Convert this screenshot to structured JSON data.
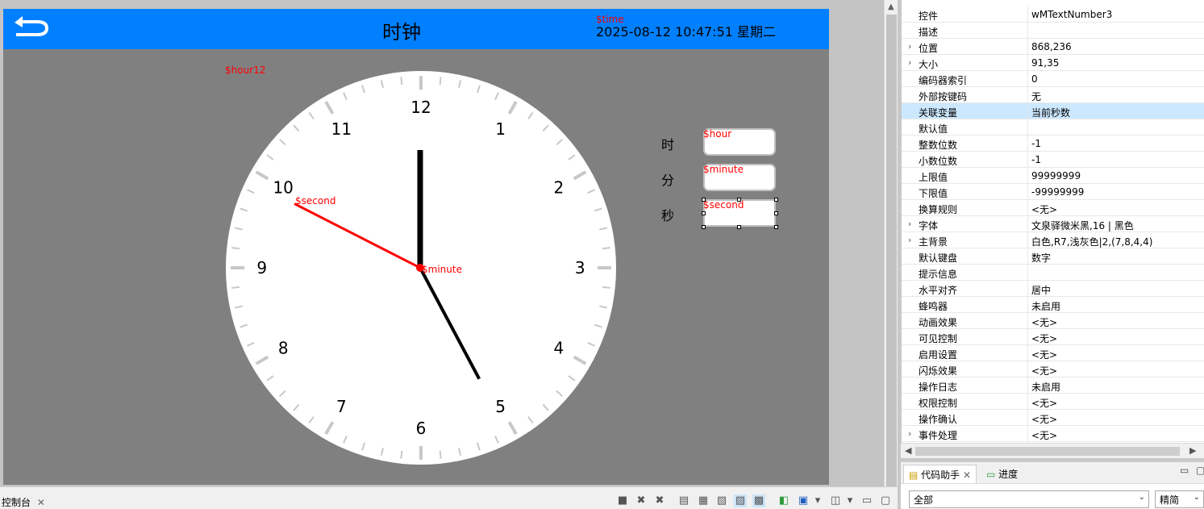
{
  "screen": {
    "title": "时钟",
    "time_text": "2025-08-12 10:47:51 星期二",
    "time_var": "$time",
    "hour12_var": "$hour12"
  },
  "clock": {
    "numbers": [
      "12",
      "1",
      "2",
      "3",
      "4",
      "5",
      "6",
      "7",
      "8",
      "9",
      "10",
      "11"
    ],
    "second_var": "$second",
    "minute_var": "$minute",
    "hour_angle_deg": 0,
    "minute_angle_deg": 152,
    "second_angle_deg": 297
  },
  "readout": {
    "hour_label": "时",
    "minute_label": "分",
    "second_label": "秒",
    "hour_var": "$hour",
    "minute_var": "$minute",
    "second_var": "$second"
  },
  "properties": {
    "rows": [
      {
        "name": "控件",
        "value": "wMTextNumber3",
        "expandable": false
      },
      {
        "name": "描述",
        "value": "",
        "expandable": false
      },
      {
        "name": "位置",
        "value": "868,236",
        "expandable": true
      },
      {
        "name": "大小",
        "value": "91,35",
        "expandable": true
      },
      {
        "name": "编码器索引",
        "value": "0",
        "expandable": false
      },
      {
        "name": "外部按键码",
        "value": "无",
        "expandable": false
      },
      {
        "name": "关联变量",
        "value": "当前秒数",
        "expandable": false,
        "selected": true
      },
      {
        "name": "默认值",
        "value": "",
        "expandable": false
      },
      {
        "name": "整数位数",
        "value": "-1",
        "expandable": false
      },
      {
        "name": "小数位数",
        "value": "-1",
        "expandable": false
      },
      {
        "name": "上限值",
        "value": "99999999",
        "expandable": false
      },
      {
        "name": "下限值",
        "value": "-99999999",
        "expandable": false
      },
      {
        "name": "换算规则",
        "value": "<无>",
        "expandable": false
      },
      {
        "name": "字体",
        "value": "文泉驿微米黑,16 | 黑色",
        "expandable": true
      },
      {
        "name": "主背景",
        "value": "白色,R7,浅灰色|2,(7,8,4,4)",
        "expandable": true
      },
      {
        "name": "默认键盘",
        "value": "数字",
        "expandable": false
      },
      {
        "name": "提示信息",
        "value": "",
        "expandable": false
      },
      {
        "name": "水平对齐",
        "value": "居中",
        "expandable": false
      },
      {
        "name": "蜂鸣器",
        "value": "未启用",
        "expandable": false
      },
      {
        "name": "动画效果",
        "value": "<无>",
        "expandable": false
      },
      {
        "name": "可见控制",
        "value": "<无>",
        "expandable": false
      },
      {
        "name": "启用设置",
        "value": "<无>",
        "expandable": false
      },
      {
        "name": "闪烁效果",
        "value": "<无>",
        "expandable": false
      },
      {
        "name": "操作日志",
        "value": "未启用",
        "expandable": false
      },
      {
        "name": "权限控制",
        "value": "<无>",
        "expandable": false
      },
      {
        "name": "操作确认",
        "value": "<无>",
        "expandable": false
      },
      {
        "name": "事件处理",
        "value": "<无>",
        "expandable": true
      }
    ]
  },
  "assistant": {
    "tab_code": "代码助手",
    "tab_progress": "进度",
    "scope": "全部",
    "mode": "精简"
  },
  "console": {
    "tab_label": "控制台"
  },
  "colors": {
    "header": "#0080ff",
    "screen_bg": "#808080",
    "second_hand": "#ff0000",
    "var_tag": "#ff0000"
  }
}
